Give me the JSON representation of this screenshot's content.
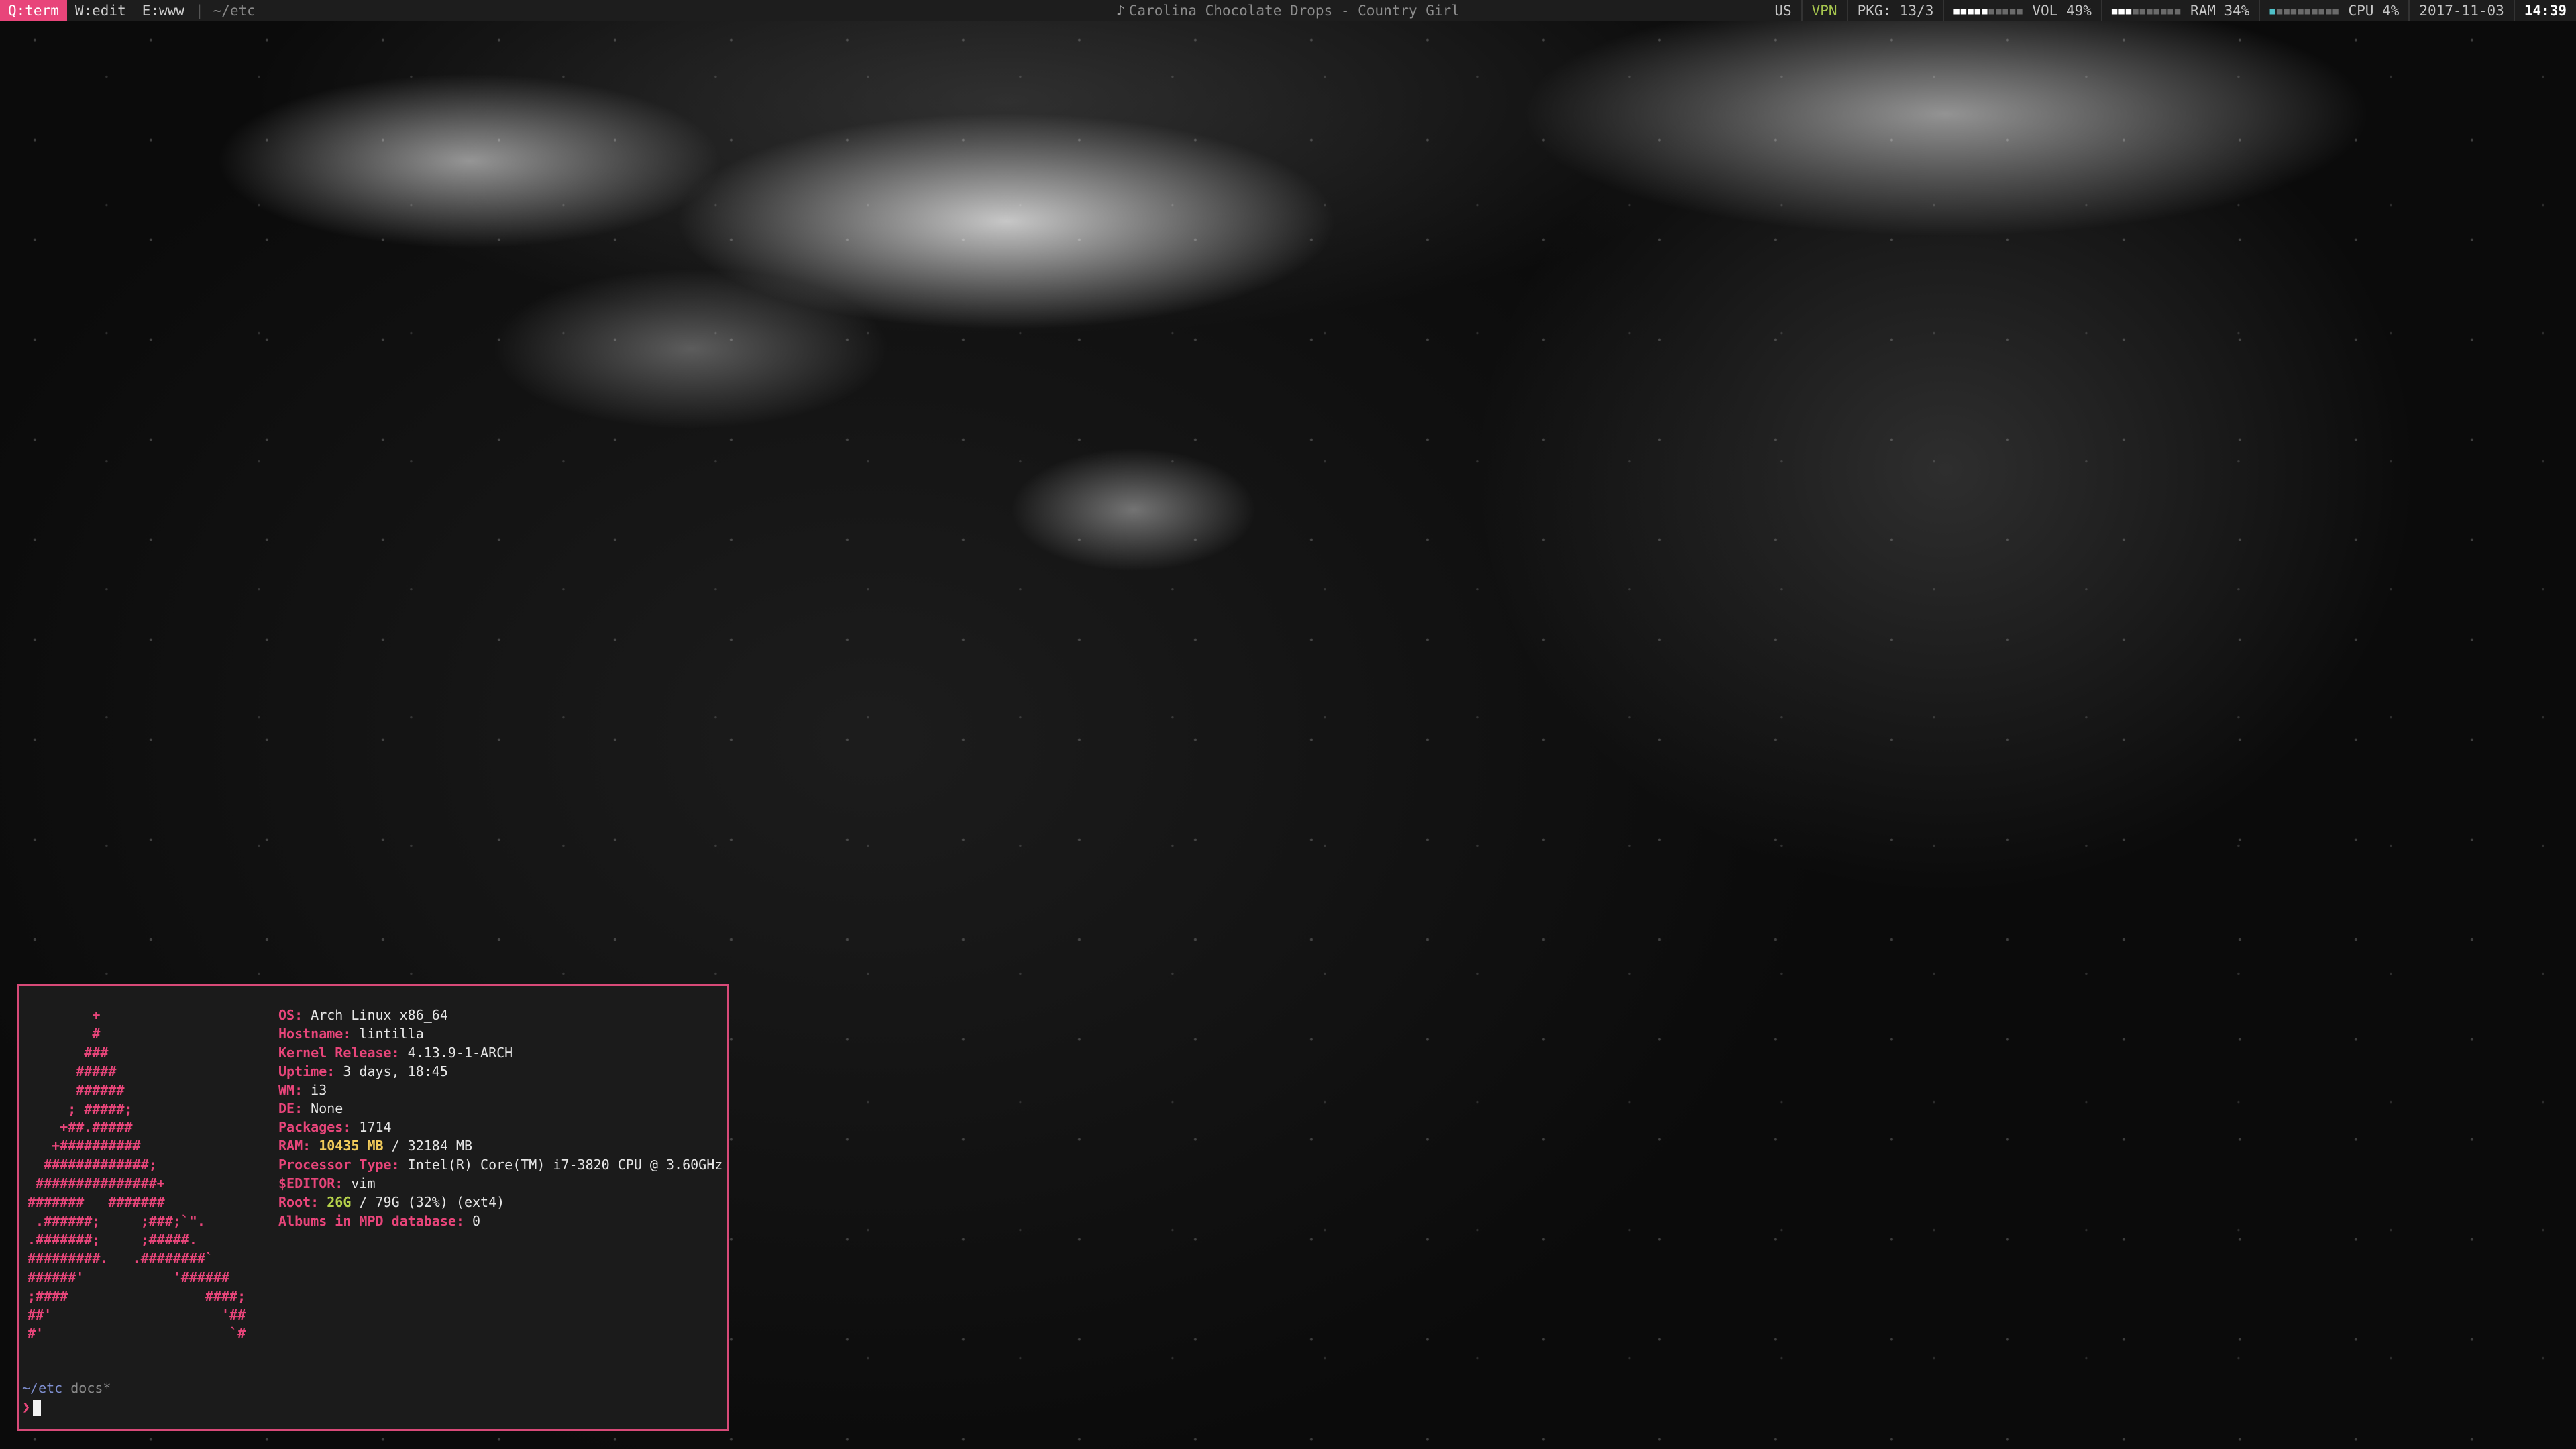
{
  "topbar": {
    "workspaces": [
      {
        "label": "Q:term",
        "active": true
      },
      {
        "label": "W:edit",
        "active": false
      },
      {
        "label": "E:www",
        "active": false
      }
    ],
    "cwd": "~/etc",
    "now_playing": "Carolina Chocolate Drops - Country Girl",
    "now_playing_icon": "music-note-icon",
    "status": {
      "layout": "US",
      "vpn": "VPN",
      "pkg": "PKG: 13/3",
      "vol_label": "VOL 49%",
      "vol_level": 0.49,
      "ram_label": "RAM 34%",
      "ram_level": 0.34,
      "cpu_label": "CPU  4%",
      "cpu_level": 0.04,
      "date": "2017-11-03",
      "time": "14:39"
    },
    "colors": {
      "accent": "#e8457a",
      "vpn": "#a7c64e",
      "cpu_meter": "#4fc1c9"
    }
  },
  "terminal": {
    "border_color": "#d84a78",
    "ascii_logo": "        +\n        #\n       ###\n      #####\n      ######\n     ; #####;\n    +##.#####\n   +##########\n  #############;\n ###############+\n#######   #######\n .######;     ;###;`\".\n.#######;     ;#####.\n#########.   .########`\n######'           '######\n;####                 ####;\n##'                     '##\n#'                       `#",
    "info": [
      {
        "key": "OS:",
        "value": "Arch Linux x86_64"
      },
      {
        "key": "Hostname:",
        "value": "lintilla"
      },
      {
        "key": "Kernel Release:",
        "value": "4.13.9-1-ARCH"
      },
      {
        "key": "Uptime:",
        "value": "3 days, 18:45"
      },
      {
        "key": "WM:",
        "value": "i3"
      },
      {
        "key": "DE:",
        "value": "None"
      },
      {
        "key": "Packages:",
        "value": "1714"
      },
      {
        "key": "RAM:",
        "value_hl": "10435 MB",
        "value": " / 32184 MB",
        "hl": "yellow"
      },
      {
        "key": "Processor Type:",
        "value": "Intel(R) Core(TM) i7-3820 CPU @ 3.60GHz"
      },
      {
        "key": "$EDITOR:",
        "value": "vim"
      },
      {
        "key": "Root:",
        "value_hl": "26G",
        "value": " / 79G (32%) (ext4)",
        "hl": "green"
      },
      {
        "key": "Albums in MPD database:",
        "value": "0"
      }
    ],
    "prompt": {
      "path": "~/etc",
      "branch": "docs*",
      "symbol": "❯"
    }
  }
}
